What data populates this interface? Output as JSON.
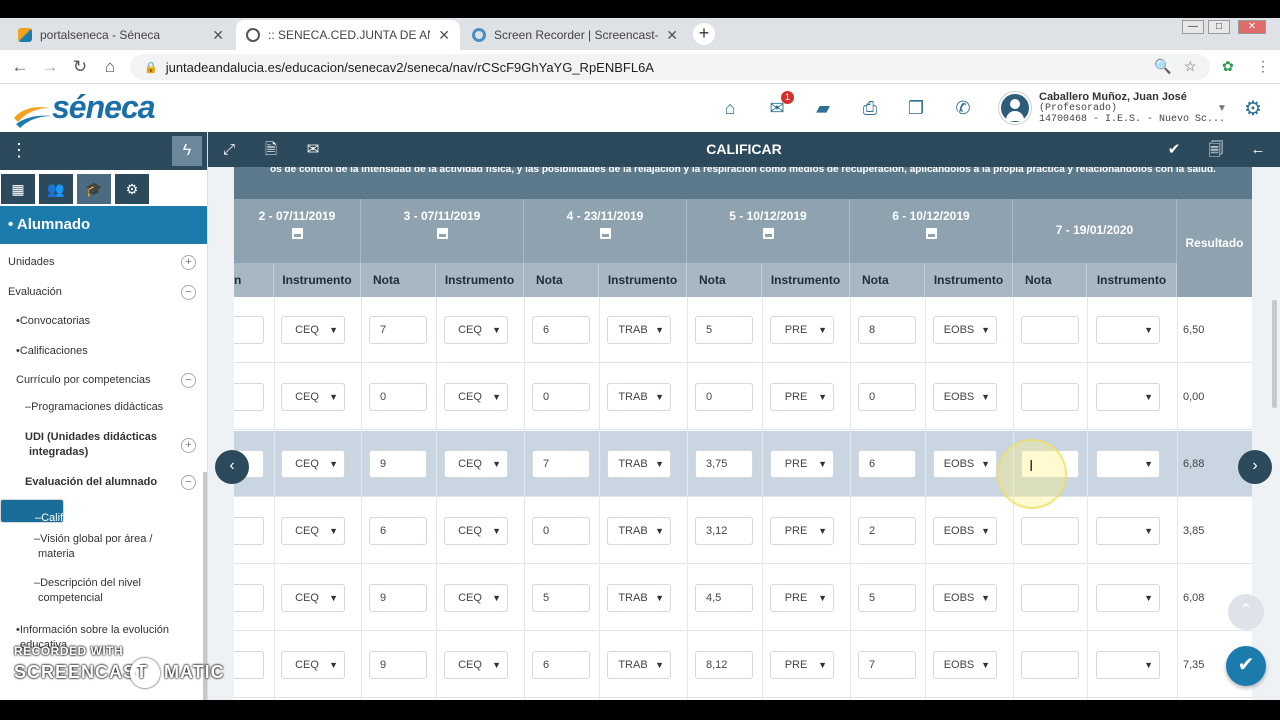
{
  "browser": {
    "tabs": [
      {
        "title": "portalseneca - Séneca"
      },
      {
        "title": ":: SENECA.CED.JUNTA DE ANDAL"
      },
      {
        "title": "Screen Recorder | Screencast-O-"
      }
    ],
    "url": "juntadeandalucia.es/educacion/senecav2/seneca/nav/rCScF9GhYaYG_RpENBFL6A"
  },
  "header": {
    "logo": "séneca",
    "mail_badge": "1",
    "user": {
      "name": "Caballero Muñoz, Juan José",
      "role": "(Profesorado)",
      "center": "14700468 - I.E.S. - Nuevo Sc..."
    }
  },
  "sidebar": {
    "section_title": "• Alumnado",
    "items": [
      {
        "label": "Unidades",
        "toggle": "+"
      },
      {
        "label": "Evaluación",
        "toggle": "−"
      },
      {
        "label": "•Convocatorias"
      },
      {
        "label": "•Calificaciones"
      },
      {
        "label": "Currículo por competencias",
        "toggle": "−"
      },
      {
        "label": "–Programaciones didácticas"
      },
      {
        "label": "UDI (Unidades didácticas",
        "label2": "integradas)",
        "toggle": "+"
      },
      {
        "label": "Evaluación del alumnado",
        "toggle": "−"
      },
      {
        "label": "–Calificar"
      },
      {
        "label": "–Visión global por área /",
        "label2": "materia"
      },
      {
        "label": "–Descripción del nivel",
        "label2": "competencial"
      },
      {
        "label": "•Información sobre la evolución",
        "label2": "educativa"
      }
    ]
  },
  "toolbar": {
    "title": "CALIFICAR"
  },
  "grid": {
    "criterion": "os de control de la intensidad de la actividad física, y las posibilidades de la relajación y la respiración como medios de recuperación, aplicándolos a la propia práctica y relacionándolos con la salud.",
    "dates": [
      "2 - 07/11/2019",
      "3 - 07/11/2019",
      "4 - 23/11/2019",
      "5 - 10/12/2019",
      "6 - 10/12/2019",
      "7 - 19/01/2020"
    ],
    "sub_headers": {
      "nota": "Nota",
      "instrumento": "Instrumento",
      "partial": "n"
    },
    "result_header": "Resultado",
    "rows": [
      {
        "cells": [
          [
            "CEQ",
            "7"
          ],
          [
            "CEQ",
            "6"
          ],
          [
            "TRAB",
            "5"
          ],
          [
            "PRE",
            "8"
          ],
          [
            "EOBS",
            ""
          ]
        ],
        "last": "",
        "result": "6,50"
      },
      {
        "cells": [
          [
            "CEQ",
            "0"
          ],
          [
            "CEQ",
            "0"
          ],
          [
            "TRAB",
            "0"
          ],
          [
            "PRE",
            "0"
          ],
          [
            "EOBS",
            ""
          ]
        ],
        "last": "",
        "result": "0,00"
      },
      {
        "cells": [
          [
            "CEQ",
            "9"
          ],
          [
            "CEQ",
            "7"
          ],
          [
            "TRAB",
            "3,75"
          ],
          [
            "PRE",
            "6"
          ],
          [
            "EOBS",
            ""
          ]
        ],
        "last": "",
        "result": "6,88"
      },
      {
        "cells": [
          [
            "CEQ",
            "6"
          ],
          [
            "CEQ",
            "0"
          ],
          [
            "TRAB",
            "3,12"
          ],
          [
            "PRE",
            "2"
          ],
          [
            "EOBS",
            ""
          ]
        ],
        "last": "",
        "result": "3,85"
      },
      {
        "cells": [
          [
            "CEQ",
            "9"
          ],
          [
            "CEQ",
            "5"
          ],
          [
            "TRAB",
            "4,5"
          ],
          [
            "PRE",
            "5"
          ],
          [
            "EOBS",
            ""
          ]
        ],
        "last": "",
        "result": "6,08"
      },
      {
        "cells": [
          [
            "CEQ",
            "9"
          ],
          [
            "CEQ",
            "6"
          ],
          [
            "TRAB",
            "8,12"
          ],
          [
            "PRE",
            "7"
          ],
          [
            "EOBS",
            ""
          ]
        ],
        "last": "",
        "result": "7,35"
      }
    ]
  },
  "watermark": {
    "line1": "RECORDED WITH",
    "line2a": "SCREENCAST",
    "line2b": "MATIC"
  }
}
